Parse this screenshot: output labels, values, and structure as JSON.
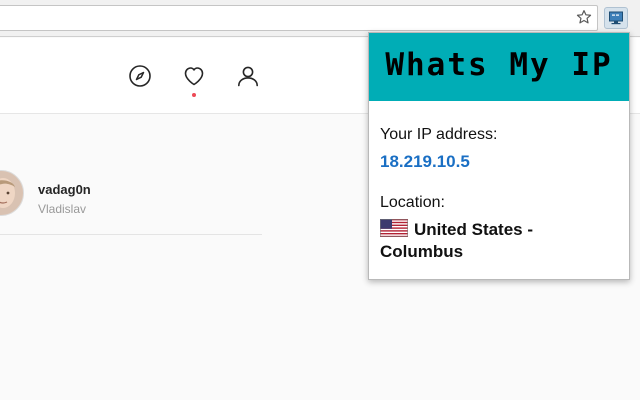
{
  "popup": {
    "title": "Whats My IP",
    "ip_label": "Your IP address:",
    "ip_value": "18.219.10.5",
    "location_label": "Location:",
    "location_value": "United States - Columbus",
    "flag_icon": "us-flag-icon",
    "header_color": "#00adb6",
    "ip_color": "#1a6fc4"
  },
  "toolbar": {
    "bookmark_icon": "star-icon",
    "extension_icon": "monitor-icon"
  },
  "nav": {
    "icons": [
      "compass-icon",
      "heart-icon",
      "person-icon"
    ],
    "notification_color": "#ed4956"
  },
  "profile": {
    "username": "vadag0n",
    "full_name": "Vladislav"
  }
}
